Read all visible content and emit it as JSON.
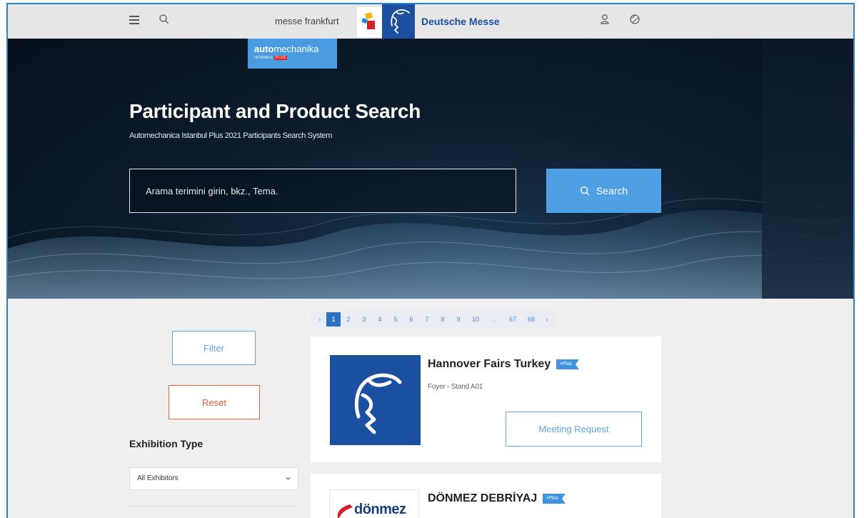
{
  "header": {
    "messe_text": "messe frankfurt",
    "dm_text": "Deutsche Messe"
  },
  "hero": {
    "logo_primary": "auto",
    "logo_secondary": "mechanika",
    "logo_tag": "ISTANBUL",
    "logo_plus": "PLUS",
    "title": "Participant and Product Search",
    "subtitle": "Automechanica Istanbul Plus 2021 Participants Search System",
    "search_placeholder": "Arama terimini girin, bkz., Tema.",
    "search_label": "Search"
  },
  "pagination": {
    "prev": "‹",
    "pages": [
      "1",
      "2",
      "3",
      "4",
      "5",
      "6",
      "7",
      "8",
      "9",
      "10",
      "...",
      "67",
      "68"
    ],
    "current": "1",
    "next": "›"
  },
  "sidebar": {
    "filter_label": "Filter",
    "reset_label": "Reset",
    "exhibition_type_title": "Exhibition Type",
    "exhibition_type_value": "All Exhibitors"
  },
  "results": [
    {
      "name": "Hannover Fairs Turkey",
      "badge": "+Plus",
      "stand": "Foyer - Stand A01",
      "action_label": "Meeting Request"
    },
    {
      "name": "DÖNMEZ DEBRİYAJ",
      "badge": "+Plus",
      "logo_text": "dönmez"
    }
  ],
  "colors": {
    "accent": "#4f9fe4",
    "brand_blue": "#1c4fa0",
    "reset_orange": "#e05f2e",
    "frame_border": "#2f7fcf"
  },
  "icons": [
    "menu-icon",
    "search-icon",
    "user-icon",
    "globe-icon",
    "chevron-down-icon",
    "prev-icon",
    "next-icon"
  ]
}
